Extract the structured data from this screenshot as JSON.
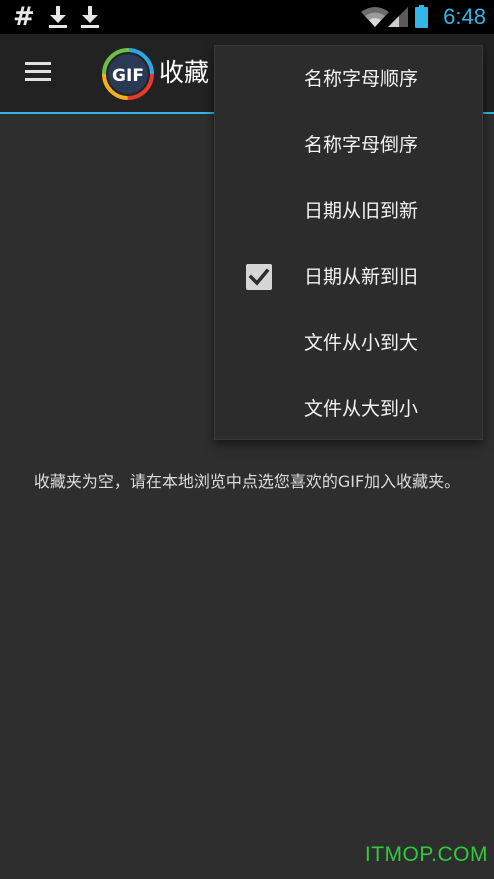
{
  "status_bar": {
    "hash_symbol": "#",
    "icons": [
      "download-icon",
      "download-icon",
      "wifi-icon",
      "signal-icon",
      "battery-icon"
    ],
    "time": "6:48",
    "time_color": "#33b5e5"
  },
  "action_bar": {
    "menu_icon": "hamburger-menu-icon",
    "logo_text": "GIF",
    "title": "收藏",
    "accent_color": "#33b5e5"
  },
  "sort_menu": {
    "items": [
      {
        "label": "名称字母顺序",
        "checked": false
      },
      {
        "label": "名称字母倒序",
        "checked": false
      },
      {
        "label": "日期从旧到新",
        "checked": false
      },
      {
        "label": "日期从新到旧",
        "checked": true
      },
      {
        "label": "文件从小到大",
        "checked": false
      },
      {
        "label": "文件从大到小",
        "checked": false
      }
    ]
  },
  "main": {
    "empty_message": "收藏夹为空，请在本地浏览中点选您喜欢的GIF加入收藏夹。"
  },
  "watermark": {
    "text": "ITMOP.COM",
    "color": "#2ecc3a"
  }
}
